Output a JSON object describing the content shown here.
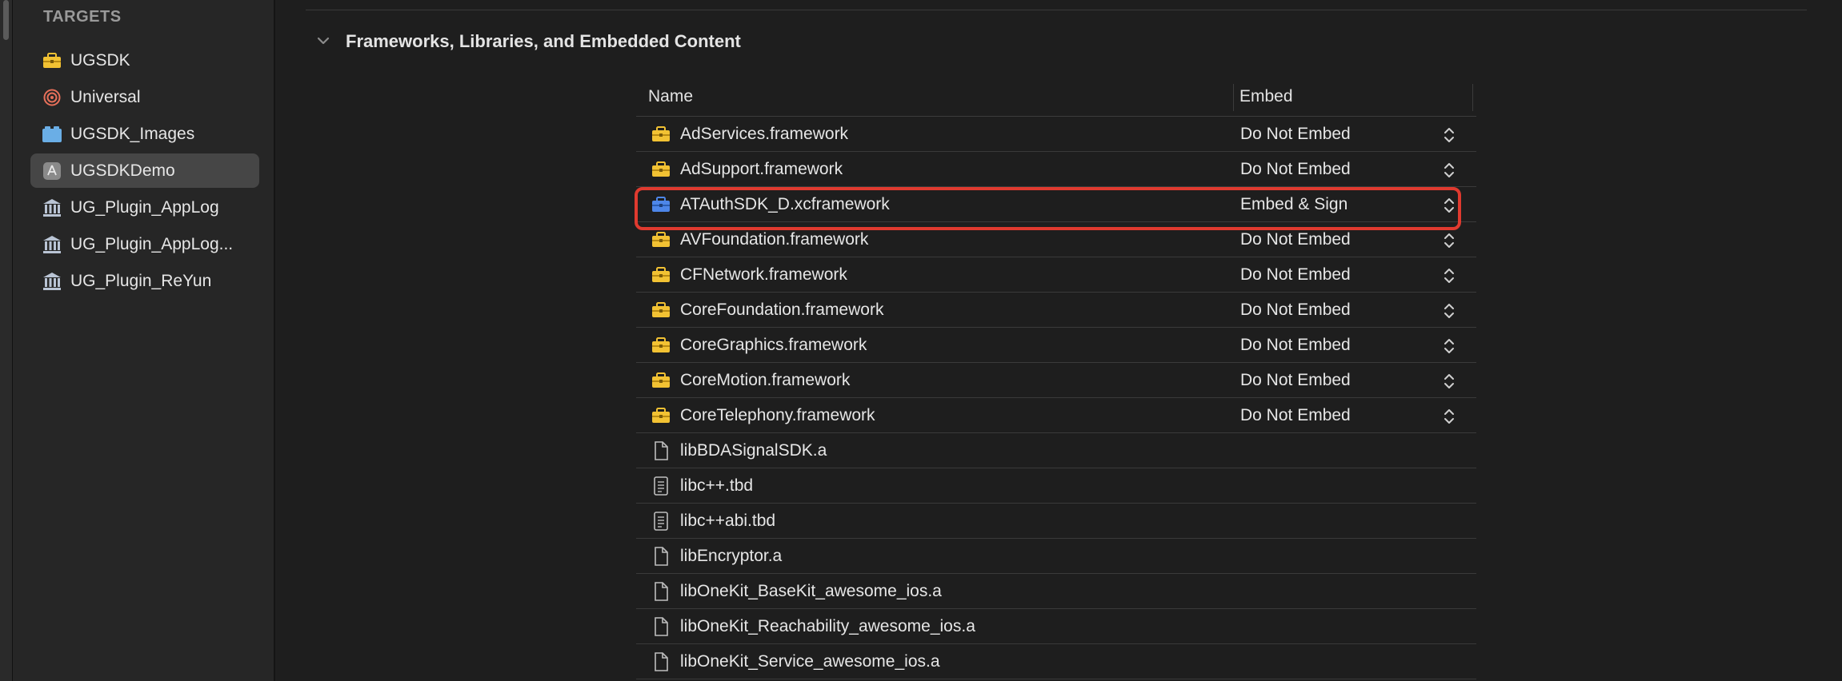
{
  "sidebar": {
    "heading": "TARGETS",
    "items": [
      {
        "label": "UGSDK",
        "icon": "toolbox-icon",
        "selected": false
      },
      {
        "label": "Universal",
        "icon": "target-icon",
        "selected": false
      },
      {
        "label": "UGSDK_Images",
        "icon": "bundle-icon",
        "selected": false
      },
      {
        "label": "UGSDKDemo",
        "icon": "app-icon",
        "selected": true
      },
      {
        "label": "UG_Plugin_AppLog",
        "icon": "library-icon",
        "selected": false
      },
      {
        "label": "UG_Plugin_AppLog...",
        "icon": "library-icon",
        "selected": false
      },
      {
        "label": "UG_Plugin_ReYun",
        "icon": "library-icon",
        "selected": false
      }
    ]
  },
  "section": {
    "title": "Frameworks, Libraries, and Embedded Content"
  },
  "table": {
    "columns": {
      "name": "Name",
      "embed": "Embed"
    },
    "rows": [
      {
        "name": "AdServices.framework",
        "embed": "Do Not Embed",
        "icon": "framework-icon"
      },
      {
        "name": "AdSupport.framework",
        "embed": "Do Not Embed",
        "icon": "framework-icon"
      },
      {
        "name": "ATAuthSDK_D.xcframework",
        "embed": "Embed & Sign",
        "icon": "xcframework-icon",
        "highlighted": true
      },
      {
        "name": "AVFoundation.framework",
        "embed": "Do Not Embed",
        "icon": "framework-icon"
      },
      {
        "name": "CFNetwork.framework",
        "embed": "Do Not Embed",
        "icon": "framework-icon"
      },
      {
        "name": "CoreFoundation.framework",
        "embed": "Do Not Embed",
        "icon": "framework-icon"
      },
      {
        "name": "CoreGraphics.framework",
        "embed": "Do Not Embed",
        "icon": "framework-icon"
      },
      {
        "name": "CoreMotion.framework",
        "embed": "Do Not Embed",
        "icon": "framework-icon"
      },
      {
        "name": "CoreTelephony.framework",
        "embed": "Do Not Embed",
        "icon": "framework-icon"
      },
      {
        "name": "libBDASignalSDK.a",
        "embed": "",
        "icon": "file-icon"
      },
      {
        "name": "libc++.tbd",
        "embed": "",
        "icon": "text-file-icon"
      },
      {
        "name": "libc++abi.tbd",
        "embed": "",
        "icon": "text-file-icon"
      },
      {
        "name": "libEncryptor.a",
        "embed": "",
        "icon": "file-icon"
      },
      {
        "name": "libOneKit_BaseKit_awesome_ios.a",
        "embed": "",
        "icon": "file-icon"
      },
      {
        "name": "libOneKit_Reachability_awesome_ios.a",
        "embed": "",
        "icon": "file-icon"
      },
      {
        "name": "libOneKit_Service_awesome_ios.a",
        "embed": "",
        "icon": "file-icon"
      }
    ]
  },
  "colors": {
    "framework_icon": "#f2c233",
    "xcframework_icon": "#4d86e8",
    "highlight": "#e03a2f",
    "selection": "#464646"
  }
}
